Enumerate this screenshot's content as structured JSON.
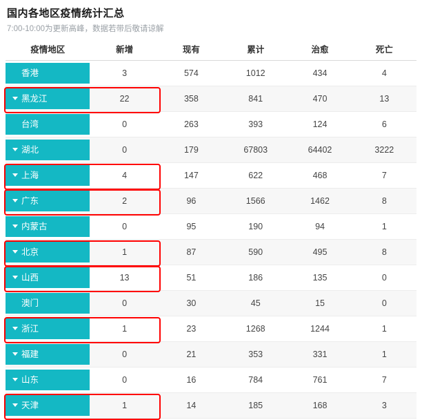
{
  "header": {
    "title": "国内各地区疫情统计汇总",
    "subtitle": "7:00-10:00为更新高峰，数据若带后敬请谅解"
  },
  "table": {
    "columns": [
      {
        "key": "region",
        "label": "疫情地区"
      },
      {
        "key": "new",
        "label": "新增"
      },
      {
        "key": "current",
        "label": "现有"
      },
      {
        "key": "total",
        "label": "累计"
      },
      {
        "key": "cured",
        "label": "治愈"
      },
      {
        "key": "deaths",
        "label": "死亡"
      }
    ],
    "rows": [
      {
        "region": "香港",
        "caret": false,
        "new": "3",
        "current": "574",
        "total": "1012",
        "cured": "434",
        "deaths": "4",
        "highlighted": false
      },
      {
        "region": "黑龙江",
        "caret": true,
        "new": "22",
        "current": "358",
        "total": "841",
        "cured": "470",
        "deaths": "13",
        "highlighted": true
      },
      {
        "region": "台湾",
        "caret": false,
        "new": "0",
        "current": "263",
        "total": "393",
        "cured": "124",
        "deaths": "6",
        "highlighted": false
      },
      {
        "region": "湖北",
        "caret": true,
        "new": "0",
        "current": "179",
        "total": "67803",
        "cured": "64402",
        "deaths": "3222",
        "highlighted": false
      },
      {
        "region": "上海",
        "caret": true,
        "new": "4",
        "current": "147",
        "total": "622",
        "cured": "468",
        "deaths": "7",
        "highlighted": true
      },
      {
        "region": "广东",
        "caret": true,
        "new": "2",
        "current": "96",
        "total": "1566",
        "cured": "1462",
        "deaths": "8",
        "highlighted": true
      },
      {
        "region": "内蒙古",
        "caret": true,
        "new": "0",
        "current": "95",
        "total": "190",
        "cured": "94",
        "deaths": "1",
        "highlighted": false
      },
      {
        "region": "北京",
        "caret": true,
        "new": "1",
        "current": "87",
        "total": "590",
        "cured": "495",
        "deaths": "8",
        "highlighted": true
      },
      {
        "region": "山西",
        "caret": true,
        "new": "13",
        "current": "51",
        "total": "186",
        "cured": "135",
        "deaths": "0",
        "highlighted": true
      },
      {
        "region": "澳门",
        "caret": false,
        "new": "0",
        "current": "30",
        "total": "45",
        "cured": "15",
        "deaths": "0",
        "highlighted": false
      },
      {
        "region": "浙江",
        "caret": true,
        "new": "1",
        "current": "23",
        "total": "1268",
        "cured": "1244",
        "deaths": "1",
        "highlighted": true
      },
      {
        "region": "福建",
        "caret": true,
        "new": "0",
        "current": "21",
        "total": "353",
        "cured": "331",
        "deaths": "1",
        "highlighted": false
      },
      {
        "region": "山东",
        "caret": true,
        "new": "0",
        "current": "16",
        "total": "784",
        "cured": "761",
        "deaths": "7",
        "highlighted": false
      },
      {
        "region": "天津",
        "caret": true,
        "new": "1",
        "current": "14",
        "total": "185",
        "cured": "168",
        "deaths": "3",
        "highlighted": true
      }
    ]
  },
  "colors": {
    "chip": "#14b8c4",
    "highlight": "#ff0000",
    "link": "#1a73e8",
    "subtitle": "#9aa0a6"
  }
}
